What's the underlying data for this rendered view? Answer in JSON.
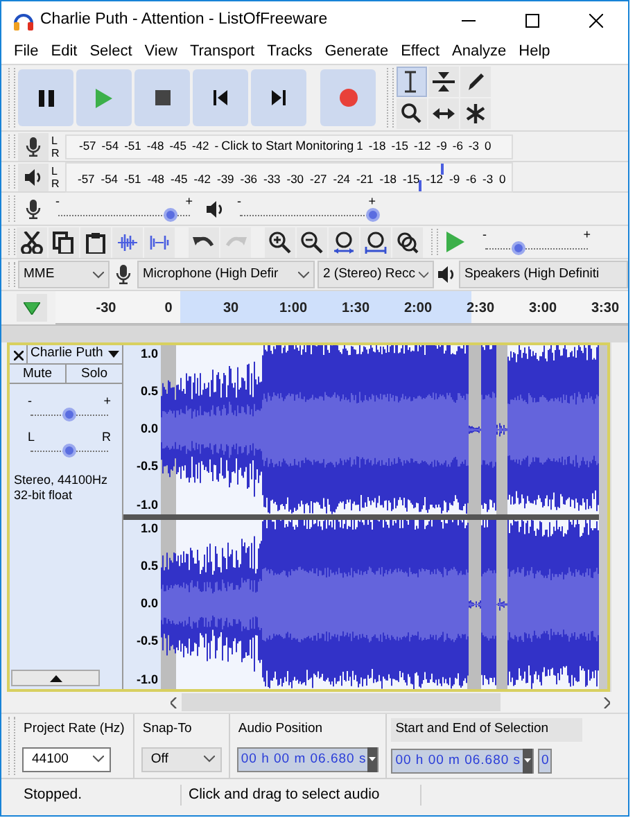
{
  "window": {
    "title": "Charlie Puth - Attention - ListOfFreeware"
  },
  "menu": [
    "File",
    "Edit",
    "Select",
    "View",
    "Transport",
    "Tracks",
    "Generate",
    "Effect",
    "Analyze",
    "Help"
  ],
  "transport": [
    {
      "kind": "pause"
    },
    {
      "kind": "play"
    },
    {
      "kind": "stop"
    },
    {
      "kind": "skip-start"
    },
    {
      "kind": "skip-end"
    },
    {
      "kind": "record"
    }
  ],
  "tools": [
    {
      "kind": "select",
      "selected": true
    },
    {
      "kind": "envelope",
      "selected": false
    },
    {
      "kind": "draw",
      "selected": false
    },
    {
      "kind": "zoom",
      "selected": false
    },
    {
      "kind": "time-shift",
      "selected": false
    },
    {
      "kind": "multi",
      "selected": false
    }
  ],
  "record_meter": {
    "channels": [
      "L",
      "R"
    ],
    "ticks_before": [
      "-57",
      "-54",
      "-51",
      "-48",
      "-45",
      "-42",
      "-"
    ],
    "prompt": "Click to Start Monitoring",
    "ticks_after": [
      "1",
      "-18",
      "-15",
      "-12",
      "-9",
      "-6",
      "-3",
      "0"
    ]
  },
  "playback_meter": {
    "channels": [
      {
        "label": "L",
        "level": 0.84
      },
      {
        "label": "R",
        "level": 0.79
      }
    ],
    "ticks": [
      "-57",
      "-54",
      "-51",
      "-48",
      "-45",
      "-42",
      "-39",
      "-36",
      "-33",
      "-30",
      "-27",
      "-24",
      "-21",
      "-18",
      "-15",
      "-12",
      "-9",
      "-6",
      "-3",
      "0"
    ]
  },
  "mixer": {
    "record_volume": {
      "minus": "-",
      "plus": "+",
      "level": 0.85
    },
    "playback_volume": {
      "minus": "-",
      "plus": "+",
      "level": 1
    }
  },
  "edit_tools": [
    {
      "kind": "cut",
      "disabled": false
    },
    {
      "kind": "copy",
      "disabled": false
    },
    {
      "kind": "paste",
      "disabled": false
    },
    {
      "kind": "trim",
      "disabled": false
    },
    {
      "kind": "silence",
      "disabled": false
    },
    {
      "kind": "undo",
      "disabled": false
    },
    {
      "kind": "redo",
      "disabled": true
    },
    {
      "kind": "zoom-in",
      "disabled": false
    },
    {
      "kind": "zoom-out",
      "disabled": false
    },
    {
      "kind": "fit-selection",
      "disabled": false
    },
    {
      "kind": "fit-project",
      "disabled": false
    },
    {
      "kind": "zoom-toggle",
      "disabled": false
    }
  ],
  "play_at_speed": {
    "minus": "-",
    "plus": "+",
    "level": 0.33
  },
  "devices": {
    "host": "MME",
    "recording_device": "Microphone (High Defir",
    "recording_channels": "2 (Stereo) Recc",
    "playback_device": "Speakers (High Definiti"
  },
  "timeline": {
    "ticks": [
      "-30",
      "0",
      "30",
      "1:00",
      "1:30",
      "2:00",
      "2:30",
      "3:00",
      "3:30"
    ]
  },
  "track": {
    "name": "Charlie Puth",
    "mute": "Mute",
    "solo": "Solo",
    "gain": {
      "minus": "-",
      "plus": "+",
      "level": 0.5
    },
    "pan": {
      "left": "L",
      "right": "R",
      "level": 0.5
    },
    "info": [
      "Stereo, 44100Hz",
      "32-bit float"
    ],
    "channels": [
      {
        "scale": [
          "1.0",
          "0.5",
          "0.0",
          "-0.5",
          "-1.0"
        ]
      },
      {
        "scale": [
          "1.0",
          "0.5",
          "0.0",
          "-0.5",
          "-1.0"
        ]
      }
    ]
  },
  "selection_toolbar": {
    "project_rate": {
      "label": "Project Rate (Hz)",
      "value": "44100"
    },
    "snap_to": {
      "label": "Snap-To",
      "value": "Off"
    },
    "audio_position": {
      "label": "Audio Position",
      "value": "00 h 00 m 06.680 s"
    },
    "selection": {
      "label": "Start and End of Selection",
      "start": "00 h 00 m 06.680 s",
      "end": "0"
    }
  },
  "status_bar": [
    "Stopped.",
    "Click and drag to select audio"
  ]
}
